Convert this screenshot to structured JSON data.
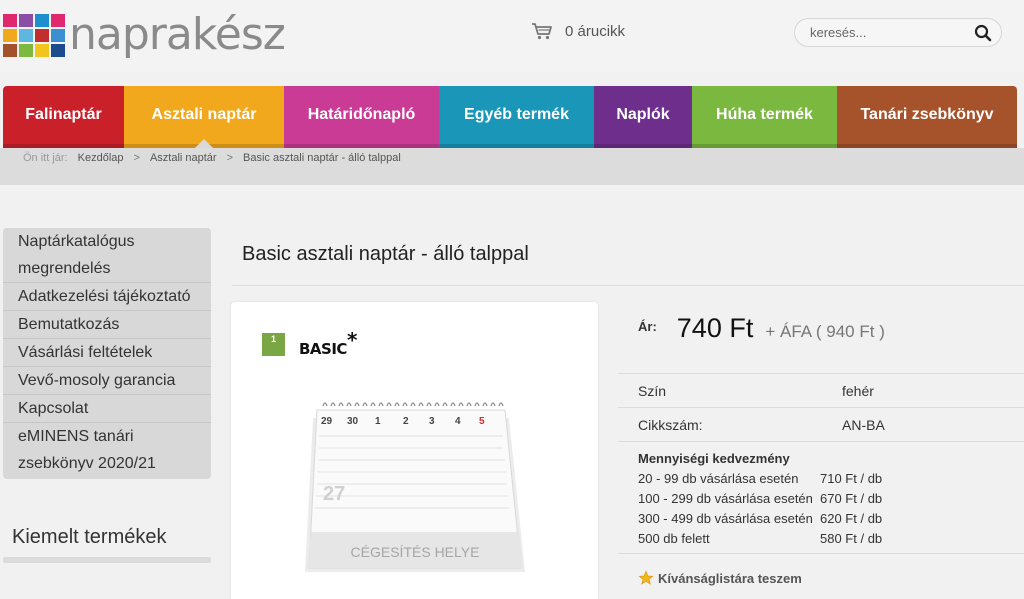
{
  "brand": {
    "logo_text": "naprakész",
    "logo_colors": [
      "#e0286f",
      "#8a4ea5",
      "#1d8fcf",
      "#e0286f",
      "#f2a81d",
      "#5fb6df",
      "#c22d2d",
      "#3c8fd1",
      "#a4522c",
      "#7db93e",
      "#f2c51e",
      "#1d4b8f"
    ]
  },
  "header": {
    "cart_label": "0 árucikk",
    "search_placeholder": "keresés..."
  },
  "nav": [
    {
      "label": "Falinaptár",
      "color": "#c9202a"
    },
    {
      "label": "Asztali naptár",
      "color": "#f2a81d"
    },
    {
      "label": "Határidőnapló",
      "color": "#c93b95"
    },
    {
      "label": "Egyéb termék",
      "color": "#1a96b9"
    },
    {
      "label": "Naplók",
      "color": "#6d2e8c"
    },
    {
      "label": "Húha termék",
      "color": "#7ab83f"
    },
    {
      "label": "Tanári zsebkönyv",
      "color": "#a6532c"
    }
  ],
  "breadcrumb": {
    "prefix": "Ön itt jár:",
    "items": [
      "Kezdőlap",
      "Asztali naptár",
      "Basic asztali naptár - álló talppal"
    ],
    "separator": ">"
  },
  "sidebar": {
    "items": [
      "Naptárkatalógus megrendelés",
      "Adatkezelési tájékoztató",
      "Bemutatkozás",
      "Vásárlási feltételek",
      "Vevő-mosoly garancia",
      "Kapcsolat",
      "eMINENS tanári zsebkönyv 2020/21"
    ],
    "featured_title": "Kiemelt termékek"
  },
  "product": {
    "title": "Basic asztali naptár - álló talppal",
    "image": {
      "badge": "1",
      "brand": "BASIC",
      "day_numbers": [
        "29",
        "30",
        "1",
        "2",
        "3",
        "4",
        "5"
      ],
      "big_day": "27",
      "print_area": "CÉGESÍTÉS HELYE"
    },
    "price_label": "Ár:",
    "price": "740 Ft",
    "price_gross": "+ ÁFA ( 940 Ft )",
    "attributes": [
      {
        "key": "Szín",
        "value": "fehér"
      },
      {
        "key": "Cikkszám:",
        "value": "AN-BA"
      }
    ],
    "discount_title": "Mennyiségi kedvezmény",
    "discounts": [
      {
        "qty": "20 - 99 db vásárlása esetén",
        "price": "710 Ft / db"
      },
      {
        "qty": "100 - 299 db vásárlása esetén",
        "price": "670 Ft / db"
      },
      {
        "qty": "300 - 499 db vásárlása esetén",
        "price": "620 Ft / db"
      },
      {
        "qty": "500 db felett",
        "price": "580 Ft / db"
      }
    ],
    "wishlist_label": "Kívánságlistára teszem"
  }
}
